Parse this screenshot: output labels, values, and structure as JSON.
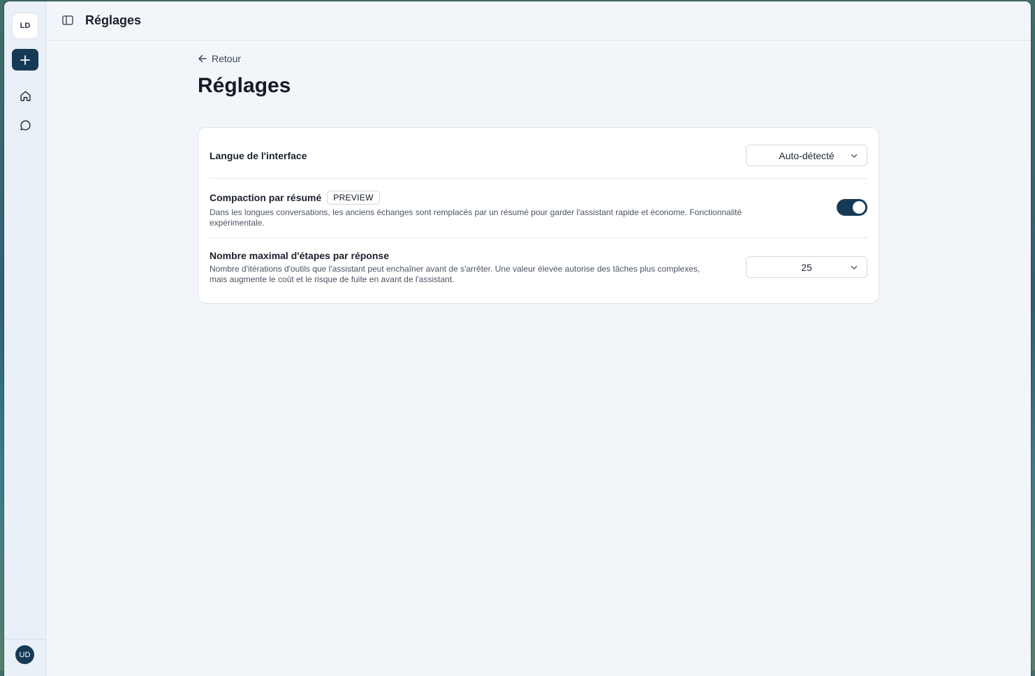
{
  "app": {
    "org_initials": "LD",
    "user_initials": "UD"
  },
  "header": {
    "title": "Réglages"
  },
  "page": {
    "back_label": "Retour",
    "title": "Réglages"
  },
  "settings": {
    "language": {
      "label": "Langue de l'interface",
      "value": "Auto-détecté"
    },
    "compaction": {
      "label": "Compaction par résumé",
      "badge": "PREVIEW",
      "description": "Dans les longues conversations, les anciens échanges sont remplacés par un résumé pour garder l'assistant rapide et économe. Fonctionnalité expérimentale.",
      "enabled": true
    },
    "max_steps": {
      "label": "Nombre maximal d'étapes par réponse",
      "description": "Nombre d'itérations d'outils que l'assistant peut enchaîner avant de s'arrêter. Une valeur élevée autorise des tâches plus complexes, mais augmente le coût et le risque de fuite en avant de l'assistant.",
      "value": "25"
    }
  },
  "colors": {
    "accent": "#163a56",
    "background": "#f2f6fa"
  },
  "icons": {
    "new": "plus-icon",
    "home": "home-icon",
    "chat": "chat-icon",
    "sidebar": "sidebar-toggle-icon",
    "back": "arrow-left-icon",
    "dropdown": "chevron-down-icon"
  }
}
